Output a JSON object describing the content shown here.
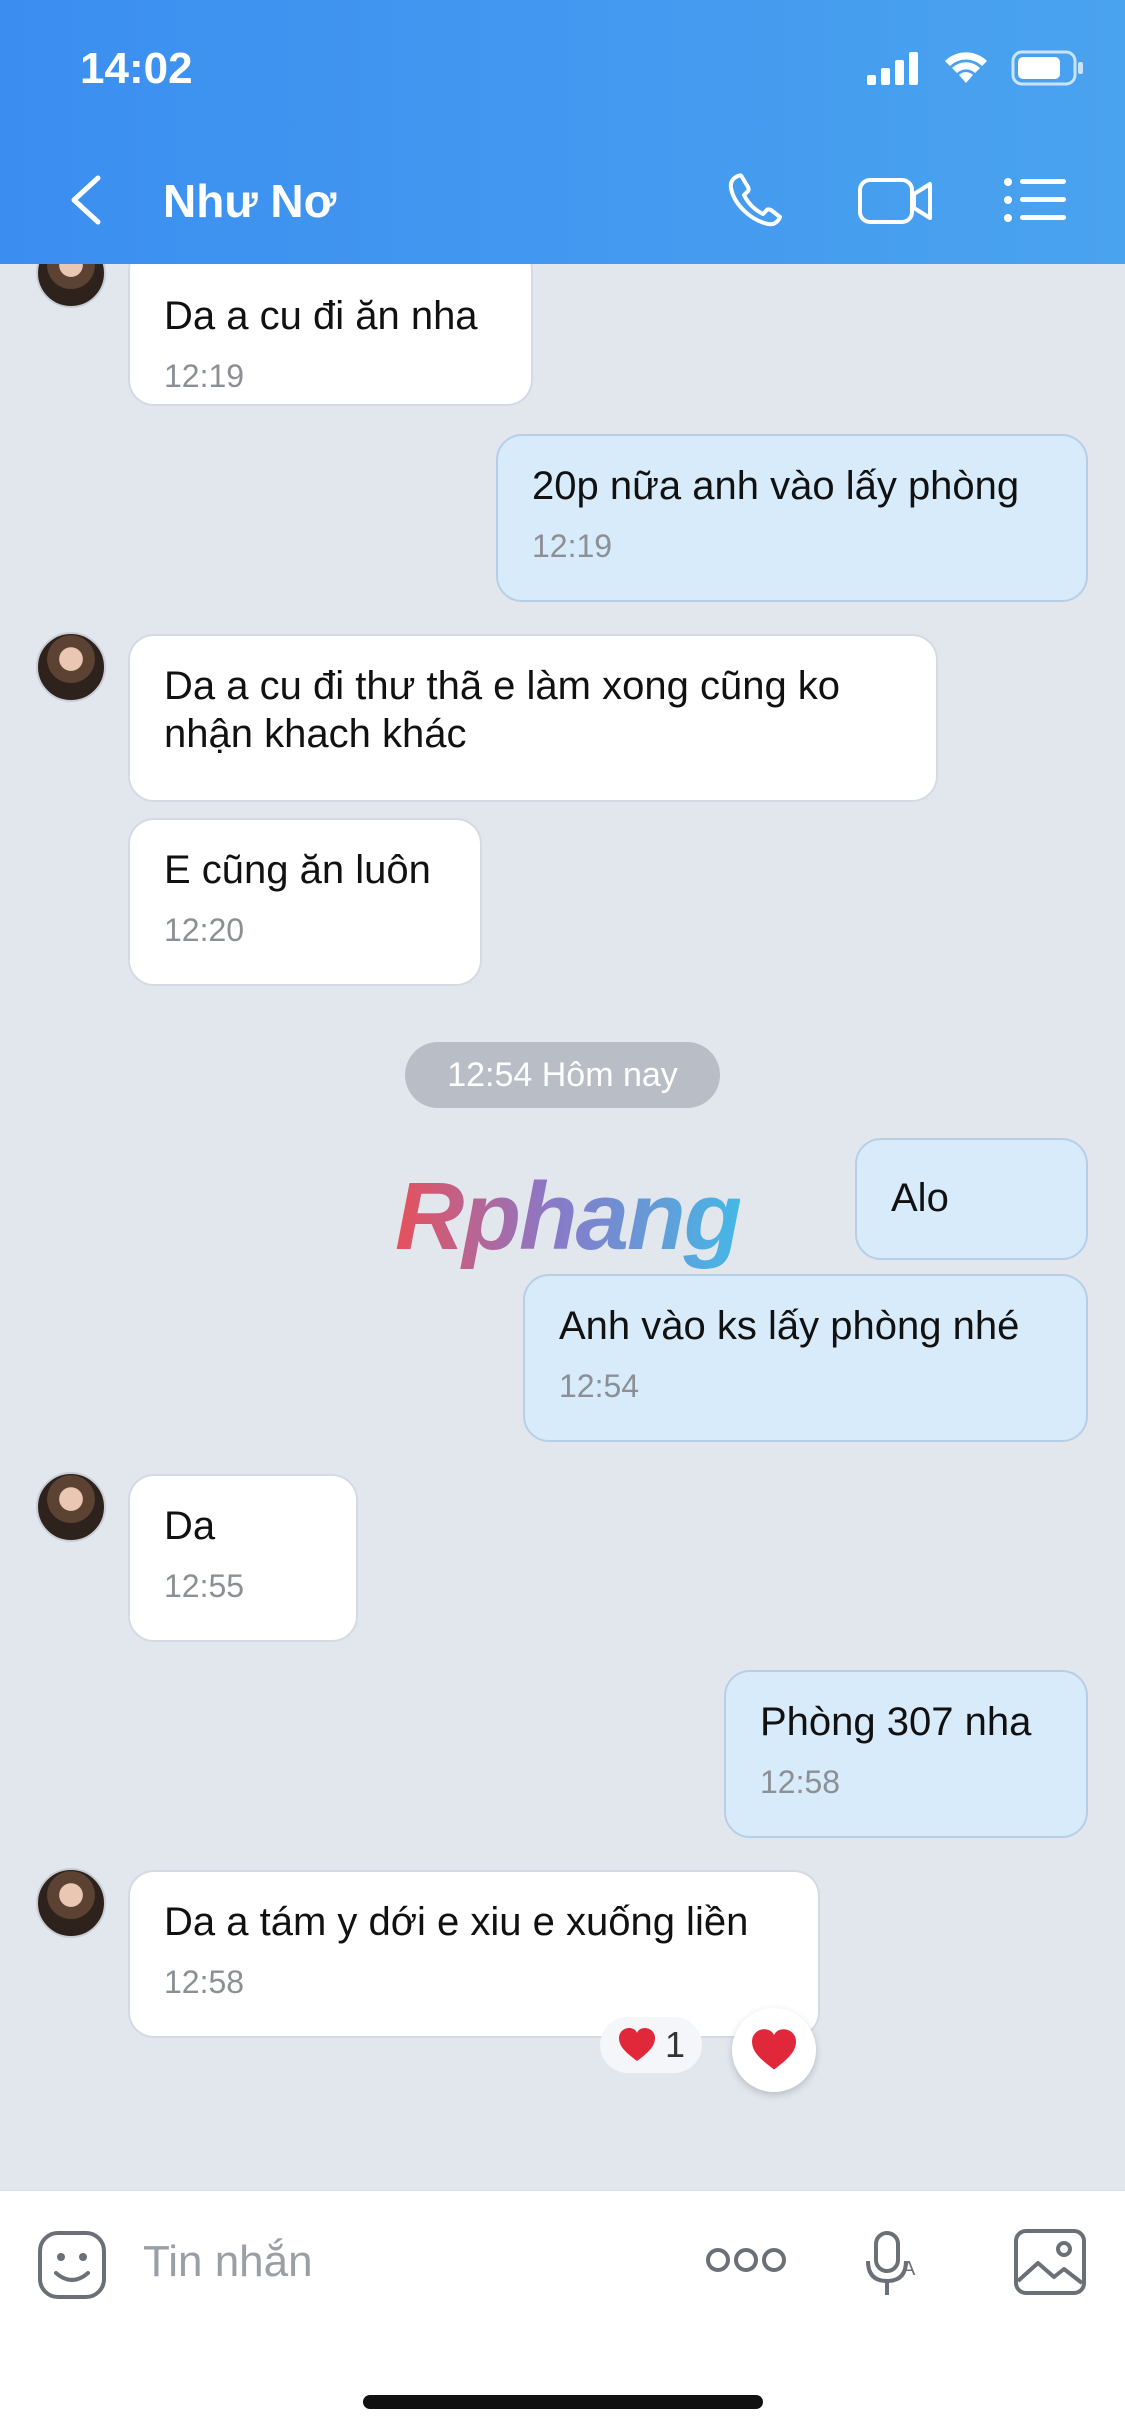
{
  "status": {
    "time": "14:02"
  },
  "header": {
    "title": "Như Nơ"
  },
  "messages": [
    {
      "text": "Da a cu đi ăn nha",
      "time": "12:19"
    },
    {
      "text": "20p nữa anh vào lấy phòng",
      "time": "12:19"
    },
    {
      "text": "Da a cu đi thư thã e làm xong cũng ko nhận khach khác"
    },
    {
      "text": "E cũng ăn luôn",
      "time": "12:20"
    },
    {
      "text": "Alo"
    },
    {
      "text": "Anh vào ks lấy phòng nhé",
      "time": "12:54"
    },
    {
      "text": "Da",
      "time": "12:55"
    },
    {
      "text": "Phòng 307 nha",
      "time": "12:58"
    },
    {
      "text": "Da a tám y dới e xiu e xuống liền",
      "time": "12:58"
    }
  ],
  "date_separator": "12:54 Hôm nay",
  "watermark": "Rphang",
  "reaction": {
    "count": "1"
  },
  "input": {
    "placeholder": "Tin nhắn"
  },
  "colors": {
    "header_start": "#3b8ef0",
    "header_end": "#4aa3ef",
    "outgoing_bubble": "#d7ebfb",
    "incoming_bubble": "#ffffff",
    "heart": "#e0283a"
  }
}
